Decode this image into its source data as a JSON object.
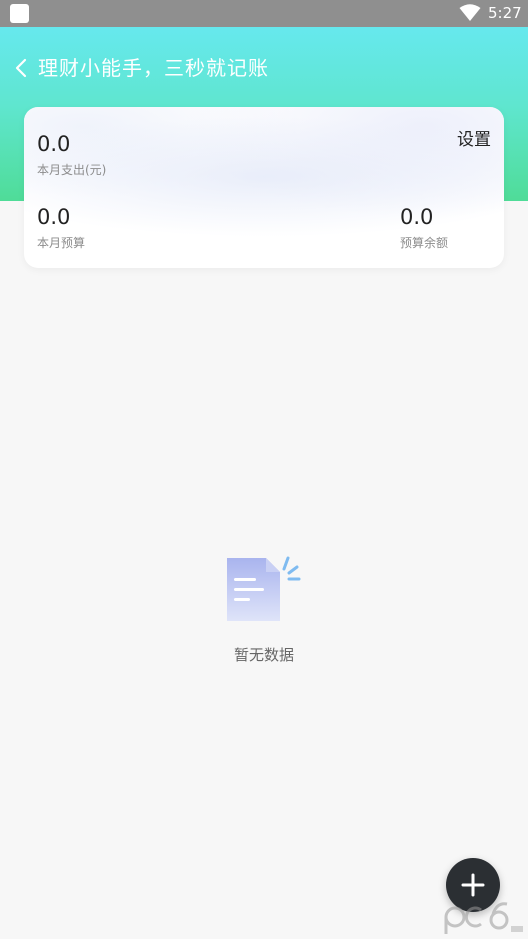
{
  "status_bar": {
    "time": "5:27",
    "icons": [
      "app-notification-icon",
      "wifi-icon"
    ]
  },
  "header": {
    "title": "理财小能手，三秒就记账",
    "back_icon": "back-arrow-icon",
    "gradient_colors": [
      "#66e8ee",
      "#4fdc98"
    ]
  },
  "summary_card": {
    "month_expense": {
      "value": "0.0",
      "label": "本月支出(元)"
    },
    "settings_label": "设置",
    "month_budget": {
      "value": "0.0",
      "label": "本月预算"
    },
    "budget_remaining": {
      "value": "0.0",
      "label": "预算余额"
    }
  },
  "empty_state": {
    "icon": "empty-document-icon",
    "text": "暂无数据"
  },
  "fab": {
    "icon": "plus-icon",
    "color": "#2b2f33"
  },
  "watermark": {
    "icon": "pc6-logo-watermark"
  }
}
